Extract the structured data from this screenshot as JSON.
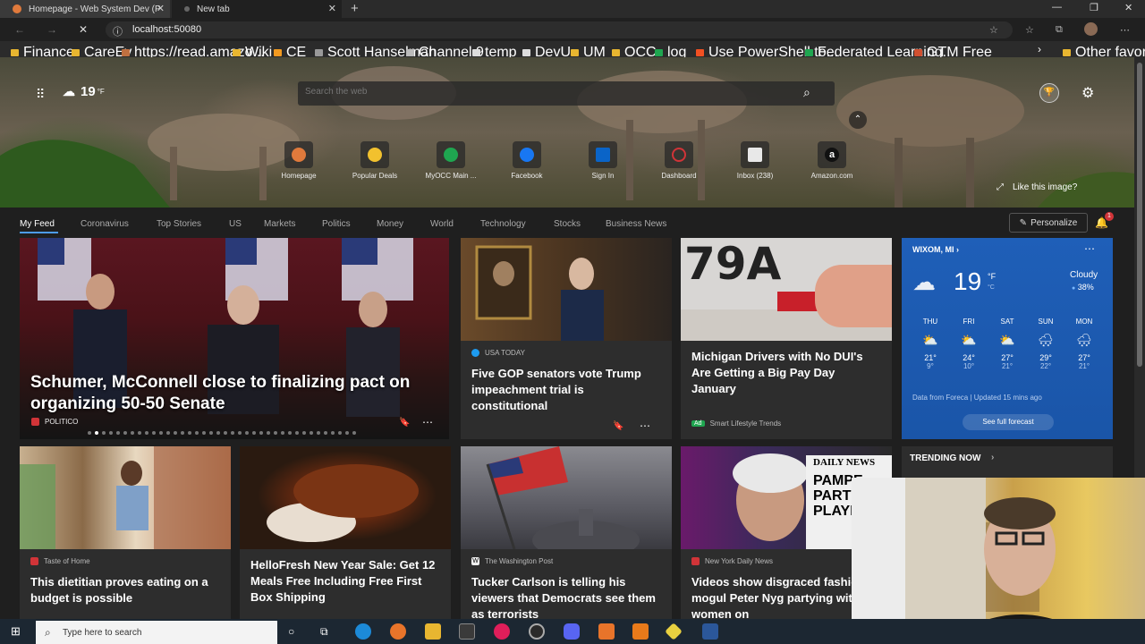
{
  "browser": {
    "tabs": [
      {
        "label": "Homepage - Web System Dev (P",
        "close": "✕"
      },
      {
        "label": "New tab",
        "close": "✕"
      }
    ],
    "new_tab": "+",
    "url": "localhost:50080",
    "window_controls": [
      "—",
      "❐",
      "✕"
    ]
  },
  "favorites": {
    "items": [
      "Finance",
      "CareEv",
      "https://read.amazo...",
      "Wiki",
      "CE",
      "Scott Hanselman",
      "Channel 9",
      "temp",
      "DevU",
      "UM",
      "OCC",
      "log",
      "Use PowerShell to...",
      "Federated Learning...",
      "GTM Free"
    ],
    "more": "›",
    "other": "Other favorites"
  },
  "hero": {
    "weather_temp": "19",
    "weather_unit": "°F",
    "search_placeholder": "Search the web",
    "quick_links": [
      {
        "label": "Homepage",
        "color": "#e07a3c"
      },
      {
        "label": "Popular Deals",
        "color": "#f2c12e"
      },
      {
        "label": "MyOCC Main ...",
        "color": "#1fa650"
      },
      {
        "label": "Facebook",
        "color": "#1877f2"
      },
      {
        "label": "Sign In",
        "color": "#0a64c8"
      },
      {
        "label": "Dashboard",
        "color": "#d13438"
      },
      {
        "label": "Inbox (238)",
        "color": "#e8e8e8"
      },
      {
        "label": "Amazon.com",
        "color": "#111111"
      }
    ],
    "like_image": "Like this image?"
  },
  "feed_nav": {
    "tabs": [
      "My Feed",
      "Coronavirus",
      "Top Stories",
      "US",
      "Markets",
      "Politics",
      "Money",
      "World",
      "Technology",
      "Stocks",
      "Business News"
    ],
    "personalize": "Personalize",
    "notification_count": "1"
  },
  "cards": {
    "hero": {
      "title": "Schumer, McConnell close to finalizing pact on organizing 50-50 Senate",
      "source": "POLITICO"
    },
    "c2": {
      "source": "USA TODAY",
      "title": "Five GOP senators vote Trump impeachment trial is constitutional"
    },
    "c3": {
      "title": "Michigan Drivers with No DUI's Are Getting a Big Pay Day January",
      "ad": "Ad",
      "source": "Smart Lifestyle Trends",
      "plate": "79A"
    },
    "r2c1": {
      "source": "Taste of Home",
      "title": "This dietitian proves eating on a budget is possible"
    },
    "r2c2": {
      "title": "HelloFresh New Year Sale: Get 12 Meals Free Including Free First Box Shipping"
    },
    "r2c3": {
      "source": "The Washington Post",
      "title": "Tucker Carlson is telling his viewers that Democrats see them as terrorists"
    },
    "r2c4": {
      "source": "New York Daily News",
      "title": "Videos show disgraced fashion mogul Peter Nyg partying with women on",
      "paper": "DAILY NEWS",
      "headline": "PAMPE PARTY PLAYBO"
    }
  },
  "weather": {
    "location": "WIXOM, MI",
    "temp": "19",
    "unit_f": "°F",
    "unit_c": "°C",
    "condition": "Cloudy",
    "precip": "38%",
    "days": [
      {
        "day": "THU",
        "hi": "21°",
        "lo": "9°"
      },
      {
        "day": "FRI",
        "hi": "24°",
        "lo": "10°"
      },
      {
        "day": "SAT",
        "hi": "27°",
        "lo": "21°"
      },
      {
        "day": "SUN",
        "hi": "29°",
        "lo": "22°"
      },
      {
        "day": "MON",
        "hi": "27°",
        "lo": "21°"
      }
    ],
    "footer": "Data from Foreca | Updated 15 mins ago",
    "forecast_btn": "See full forecast"
  },
  "trending": {
    "label": "TRENDING NOW"
  },
  "taskbar": {
    "search_placeholder": "Type here to search"
  }
}
